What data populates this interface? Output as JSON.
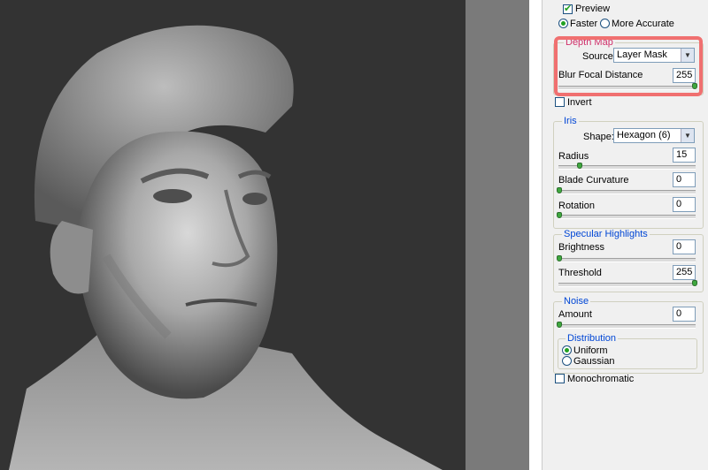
{
  "panel": {
    "preview": {
      "label": "Preview",
      "checked": true
    },
    "quality": {
      "options": [
        "Faster",
        "More Accurate"
      ],
      "selected": "Faster"
    },
    "depth_map": {
      "title": "Depth Map",
      "source_label": "Source:",
      "source_value": "Layer Mask",
      "blur_label": "Blur Focal Distance",
      "blur_value": "255",
      "blur_slider": 1.0
    },
    "invert": {
      "label": "Invert",
      "checked": false
    },
    "iris": {
      "title": "Iris",
      "shape_label": "Shape:",
      "shape_value": "Hexagon (6)",
      "radius_label": "Radius",
      "radius_value": "15",
      "radius_slider": 0.15,
      "curvature_label": "Blade Curvature",
      "curvature_value": "0",
      "rotation_label": "Rotation",
      "rotation_value": "0"
    },
    "specular": {
      "title": "Specular Highlights",
      "brightness_label": "Brightness",
      "brightness_value": "0",
      "threshold_label": "Threshold",
      "threshold_value": "255"
    },
    "noise": {
      "title": "Noise",
      "amount_label": "Amount",
      "amount_value": "0",
      "distribution": {
        "title": "Distribution",
        "options": [
          "Uniform",
          "Gaussian"
        ],
        "selected": "Uniform"
      },
      "monochromatic": {
        "label": "Monochromatic",
        "checked": false
      }
    }
  },
  "colors": {
    "accent": "#0046d5",
    "slider_thumb": "#3fa83f",
    "highlight": "#f07070",
    "canvas_bg": "#333333"
  }
}
